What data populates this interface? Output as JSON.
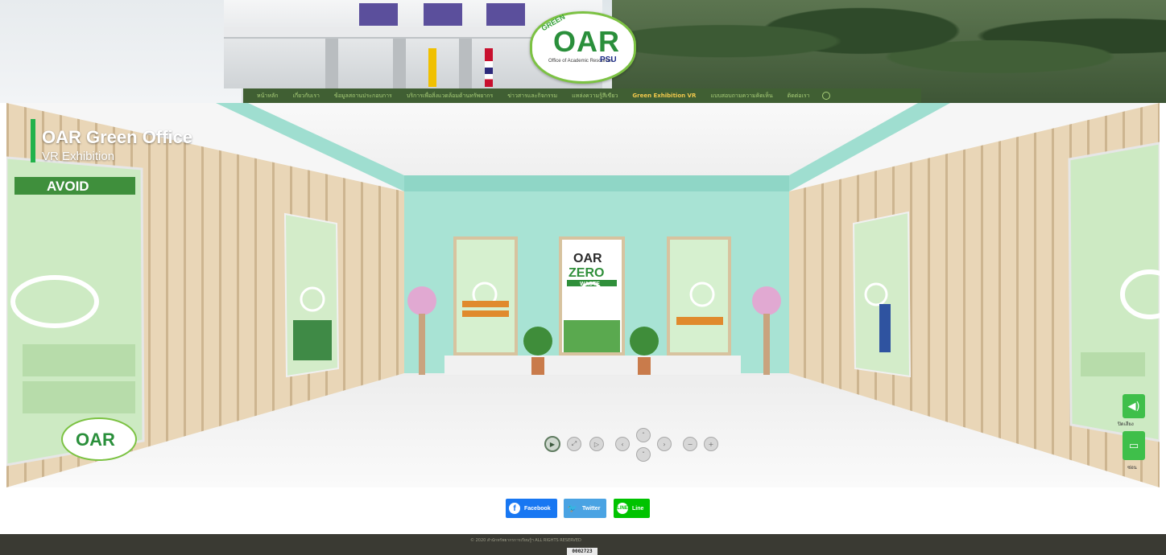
{
  "header": {
    "logo": {
      "badge": "GREEN",
      "name": "OAR",
      "subtitle": "Office of Academic Resources",
      "org": "PSU"
    }
  },
  "nav": {
    "items": [
      {
        "label": "หน้าหลัก"
      },
      {
        "label": "เกี่ยวกับเรา"
      },
      {
        "label": "ข้อมูลสถานประกอบการ"
      },
      {
        "label": "บริการเพื่อสิ่งแวดล้อมด้านทรัพยากร"
      },
      {
        "label": "ข่าวสารและกิจกรรม"
      },
      {
        "label": "แหล่งความรู้สีเขียว"
      },
      {
        "label": "Green Exhibition VR",
        "active": true
      },
      {
        "label": "แบบสอบถามความคิดเห็น"
      },
      {
        "label": "ติดต่อเรา"
      }
    ],
    "search_icon": "search-icon"
  },
  "vr": {
    "title": "OAR Green Office",
    "subtitle": "VR Exhibition",
    "posters": {
      "left_big": {
        "heading": "AVOID"
      },
      "center": {
        "line1": "OAR",
        "line2": "ZERO",
        "line3": "WASTE"
      },
      "floor_logo": "OAR"
    },
    "controls": [
      {
        "name": "play",
        "glyph": "▶"
      },
      {
        "name": "fullscreen",
        "glyph": "⤢"
      },
      {
        "name": "pause",
        "glyph": "▷"
      },
      {
        "name": "left",
        "glyph": "‹"
      },
      {
        "name": "up",
        "glyph": "ˆ"
      },
      {
        "name": "down",
        "glyph": "ˇ"
      },
      {
        "name": "right",
        "glyph": "›"
      },
      {
        "name": "zoom-out",
        "glyph": "−"
      },
      {
        "name": "zoom-in",
        "glyph": "+"
      }
    ],
    "side": {
      "sound_label": "ปิดเสียง",
      "hide_label": "ซ่อน"
    }
  },
  "share": {
    "facebook": "Facebook",
    "twitter": "Twitter",
    "line": "Line"
  },
  "footer": {
    "copyright": "© 2020 สำนักทรัพยากรการเรียนรู้ฯ ALL RIGHTS RESERVED",
    "counter": "0002723"
  },
  "colors": {
    "nav_bg": "#405f33",
    "nav_text": "#a8cf78",
    "nav_active": "#f2c94c",
    "accent_green": "#23b24b",
    "facebook": "#1877f2",
    "twitter": "#4aa3e3",
    "line": "#00c300",
    "footer_bg": "#3a3a33"
  }
}
